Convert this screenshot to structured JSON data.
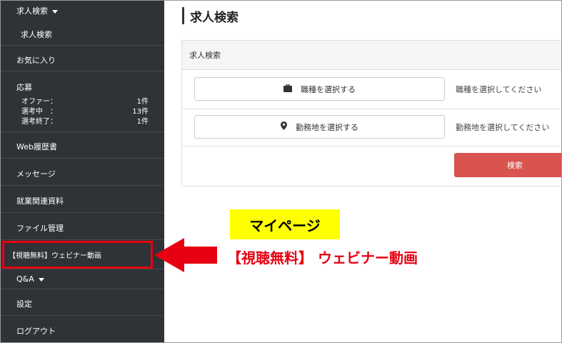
{
  "sidebar": {
    "job_search": "求人検索",
    "job_search_sub": "求人検索",
    "favorites": "お気に入り",
    "applications": {
      "title": "応募",
      "rows": [
        {
          "label": "オファー：",
          "value": "1件"
        },
        {
          "label": "選考中　：",
          "value": "13件"
        },
        {
          "label": "選考終了：",
          "value": "1件"
        }
      ]
    },
    "web_resume": "Web履歴書",
    "messages": "メッセージ",
    "job_materials": "就業関連資料",
    "file_management": "ファイル管理",
    "webinar": "【視聴無料】ウェビナー動画",
    "qa": "Q&A",
    "settings": "設定",
    "logout": "ログアウト"
  },
  "main": {
    "page_title": "求人検索",
    "panel_title": "求人検索",
    "occupation_button": "職種を選択する",
    "occupation_hint": "職種を選択してください",
    "location_button": "勤務地を選択する",
    "location_hint": "勤務地を選択してください",
    "search_button": "検索"
  },
  "annotation": {
    "mypage_label": "マイページ",
    "webinar_label": "【視聴無料】 ウェビナー動画"
  },
  "colors": {
    "sidebar_bg": "#2f3337",
    "highlight_red": "#e60012",
    "search_button": "#d9534f",
    "label_yellow": "#ffff00"
  },
  "icons": {
    "occupation": "briefcase-icon",
    "location": "map-pin-icon",
    "dropdown": "caret-down-icon",
    "annotation_arrow": "left-arrow-icon"
  }
}
